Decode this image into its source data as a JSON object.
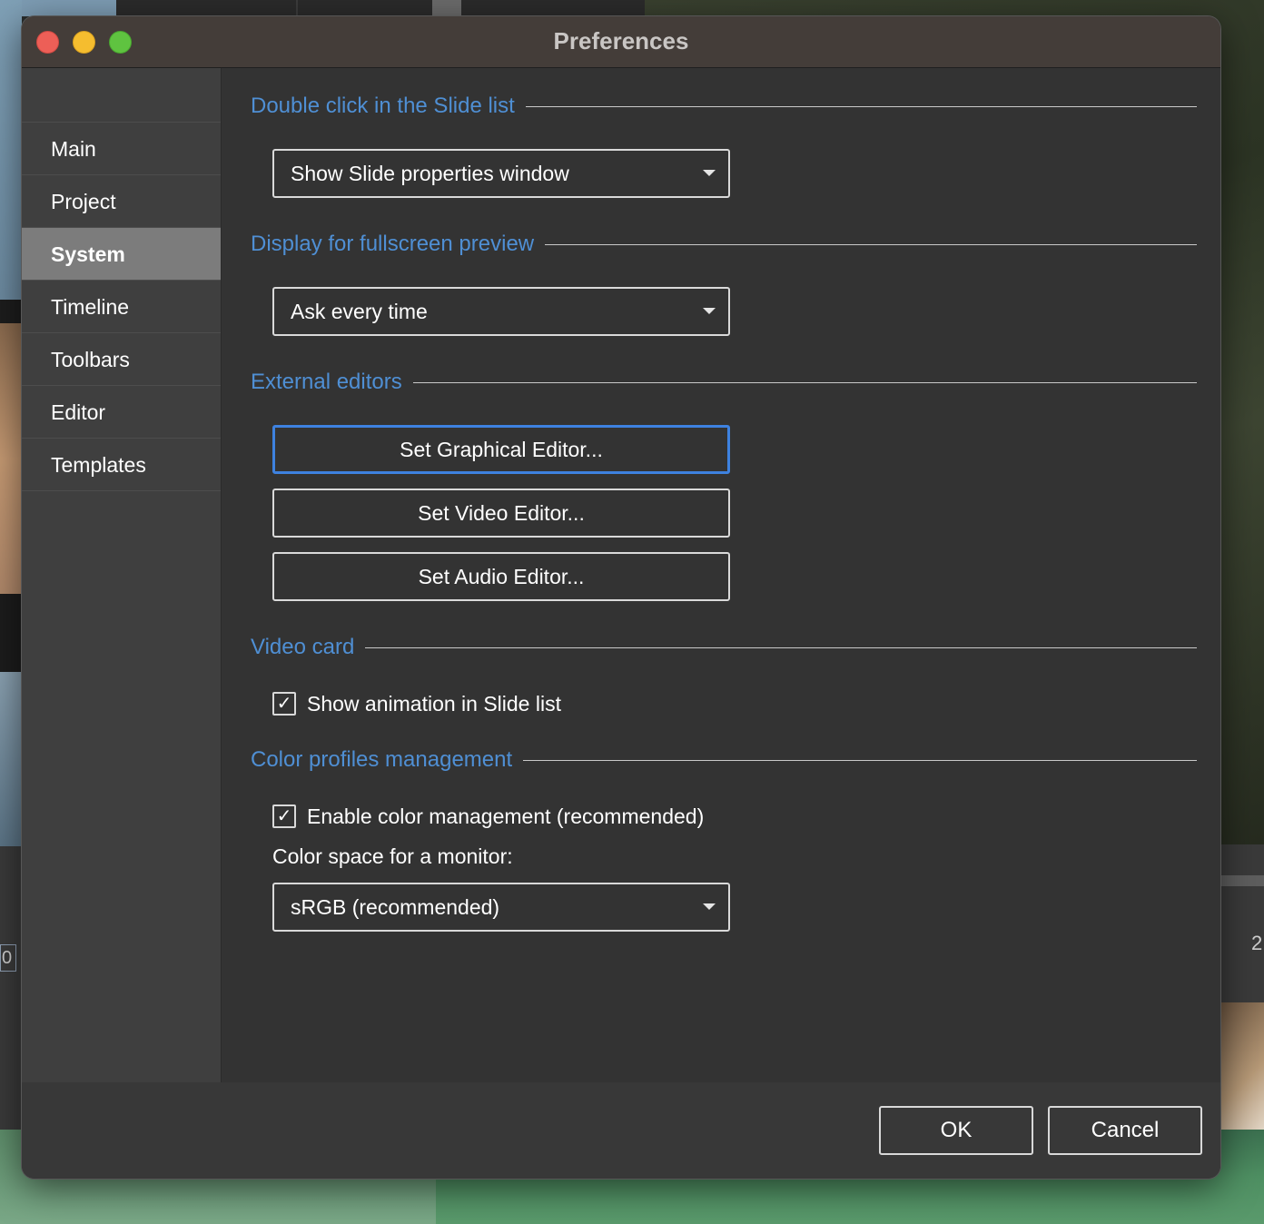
{
  "background": {
    "left_counter": "0",
    "right_counter": "2"
  },
  "window": {
    "title": "Preferences"
  },
  "sidebar": {
    "items": [
      {
        "label": "Main",
        "active": false
      },
      {
        "label": "Project",
        "active": false
      },
      {
        "label": "System",
        "active": true
      },
      {
        "label": "Timeline",
        "active": false
      },
      {
        "label": "Toolbars",
        "active": false
      },
      {
        "label": "Editor",
        "active": false
      },
      {
        "label": "Templates",
        "active": false
      }
    ]
  },
  "sections": {
    "double_click": {
      "title": "Double click in the Slide list",
      "select_value": "Show Slide properties window"
    },
    "fullscreen": {
      "title": "Display for fullscreen preview",
      "select_value": "Ask every time"
    },
    "external_editors": {
      "title": "External editors",
      "graphical_button": "Set Graphical Editor...",
      "video_button": "Set Video Editor...",
      "audio_button": "Set Audio Editor..."
    },
    "video_card": {
      "title": "Video card",
      "show_animation_label": "Show animation in Slide list",
      "show_animation_checked": true
    },
    "color_profiles": {
      "title": "Color profiles management",
      "enable_label": "Enable color management (recommended)",
      "enable_checked": true,
      "monitor_label": "Color space for a monitor:",
      "monitor_value": "sRGB (recommended)"
    }
  },
  "footer": {
    "ok_label": "OK",
    "cancel_label": "Cancel"
  },
  "colors": {
    "accent": "#4f8fd4",
    "focus_ring": "#3e82e0",
    "titlebar": "#443d39",
    "panel": "#333333",
    "sidebar": "#3f3f3f",
    "sidebar_active": "#7c7c7c"
  }
}
